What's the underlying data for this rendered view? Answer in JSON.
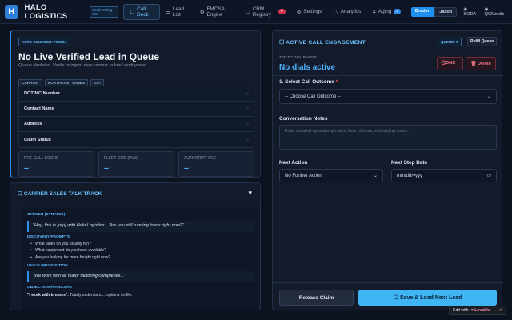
{
  "header": {
    "logo_letter": "H",
    "brand": "HALO LOGISTICS",
    "brand_badge": "Lead Vetting OS",
    "nav": [
      {
        "icon": "phone-icon",
        "glyph": "☐",
        "label": "Call Deck",
        "active": true
      },
      {
        "icon": "list-icon",
        "glyph": "☰",
        "label": "Lead List"
      },
      {
        "icon": "gear-icon",
        "glyph": "⚙",
        "label": "FMCSA Engine"
      },
      {
        "icon": "database-icon",
        "glyph": "☐",
        "label": "CRM Registry",
        "badge": "0"
      },
      {
        "icon": "settings-icon",
        "glyph": "⚙",
        "label": "Settings"
      },
      {
        "icon": "chart-icon",
        "glyph": "〽",
        "label": "Analytics"
      },
      {
        "icon": "hourglass-icon",
        "glyph": "⧗",
        "label": "Aging",
        "badge": "2"
      }
    ],
    "users": [
      "Braden",
      "Jacob"
    ],
    "right": [
      {
        "glyph": "◉",
        "label": "SODA"
      },
      {
        "glyph": "◉",
        "label": "QCMobile"
      }
    ]
  },
  "lead": {
    "source_chip": "AUTO-SOURCED: FMCSA",
    "title": "No Live Verified Lead in Queue",
    "subtitle": "Queue depleted. Verify or ingest new carriers to load workspace.",
    "tags": [
      "CARRIER",
      "NORTHEAST LANES",
      "EST"
    ],
    "fields": [
      {
        "label": "DOT/MC Number",
        "value": "--"
      },
      {
        "label": "Contact Name",
        "value": "--"
      },
      {
        "label": "Address",
        "value": "--"
      },
      {
        "label": "Claim Status",
        "value": "--"
      }
    ],
    "stats": [
      {
        "label": "PRE-CALL SCORE",
        "value": "--"
      },
      {
        "label": "FLEET SIZE (PUS)",
        "value": "--"
      },
      {
        "label": "AUTHORITY AGE",
        "value": "--"
      }
    ]
  },
  "talk": {
    "title": "☐ CARRIER SALES TALK TRACK",
    "toggle": "▾",
    "opener_label": "OPENER (DYNAMIC)",
    "opener": "\"Hey, this is [rep] with Halo Logistics... Are you still running loads right now?\"",
    "discovery_label": "DISCOVERY PROMPTS",
    "discovery": [
      "What lanes do you usually run?",
      "What equipment do you have available?",
      "Are you looking for more freight right now?"
    ],
    "value_label": "VALUE PROPOSITION",
    "value": "\"We work with all major factoring companies...\"",
    "objection_label": "OBJECTION HANDLERS",
    "objection_key": "\"I work with brokers\":",
    "objection_text": " Totally understand... options on file."
  },
  "call": {
    "title": "☐ ACTIVE CALL ENGAGEMENT",
    "queue": "QUEUE: 0",
    "refill": "Refill Queue",
    "tap_label": "TAP TO DIAL PHONE",
    "no_dials": "No dials active",
    "dnc": "⃠ DNC",
    "delete": "🗑 Delete",
    "outcome_label": "1. Select Call Outcome",
    "required": "*",
    "outcome_value": "-- Choose Call Outcome --",
    "notes_label": "Conversation Notes",
    "notes_placeholder": "Enter detailed operational notes, lane choices, scheduling notes...",
    "next_action_label": "Next Action",
    "next_action_value": "No Further Action",
    "next_step_label": "Next Step Date",
    "next_step_placeholder": "mm/dd/yyyy",
    "release": "Release Claim",
    "save": "☐ Save & Load Next Lead"
  },
  "footer": {
    "edit": "Edit with",
    "brand": "♥ Lovable",
    "close": "✕"
  }
}
